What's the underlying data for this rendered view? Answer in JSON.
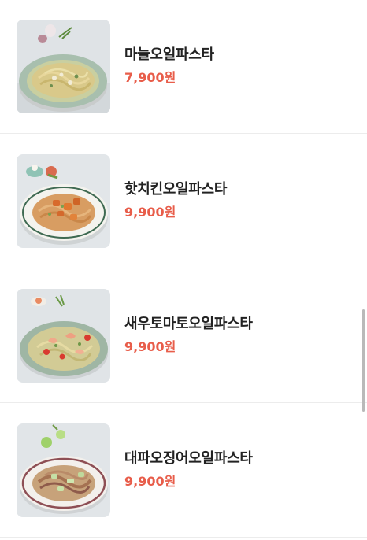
{
  "menu": {
    "items": [
      {
        "name": "마늘오일파스타",
        "price": "7,900원",
        "image": "garlic-oil-pasta-photo"
      },
      {
        "name": "핫치킨오일파스타",
        "price": "9,900원",
        "image": "hot-chicken-oil-pasta-photo"
      },
      {
        "name": "새우토마토오일파스타",
        "price": "9,900원",
        "image": "shrimp-tomato-oil-pasta-photo"
      },
      {
        "name": "대파오징어오일파스타",
        "price": "9,900원",
        "image": "green-onion-squid-oil-pasta-photo"
      }
    ]
  },
  "colors": {
    "price": "#e85d4a",
    "name": "#222222",
    "divider": "#ececec"
  }
}
